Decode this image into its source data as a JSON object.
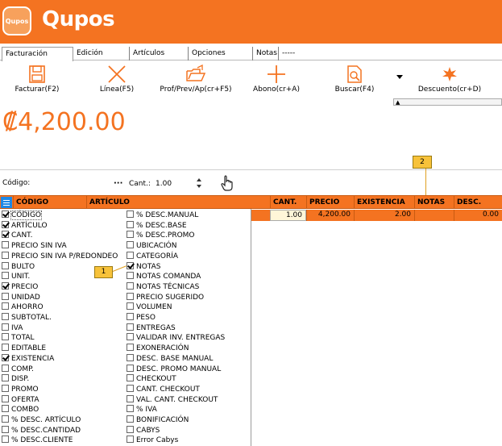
{
  "app": {
    "logo_badge": "Qupos",
    "logo_text": "Qupos",
    "brand_color": "#f47321"
  },
  "tabs": [
    "Facturación",
    "Edición",
    "Artículos",
    "Opciones",
    "Notas",
    "-----"
  ],
  "toolbar": {
    "buttons": [
      {
        "label": "Facturar(F2)",
        "icon": "save-icon"
      },
      {
        "label": "Línea(F5)",
        "icon": "close-x-icon"
      },
      {
        "label": "Prof/Prev/Ap(cr+F5)",
        "icon": "open-folder-icon"
      },
      {
        "label": "Abono(cr+A)",
        "icon": "plus-icon"
      },
      {
        "label": "Buscar(F4)",
        "icon": "search-document-icon"
      },
      {
        "label": "Descuento(cr+D)",
        "icon": "discount-icon"
      }
    ]
  },
  "total": "₡4,200.00",
  "entry": {
    "code_label": "Código:",
    "dots": "···",
    "cant_label": "Cant.:",
    "cant_value": "1.00"
  },
  "grid": {
    "headers": [
      "CÓDIGO",
      "ARTÍCULO",
      "CANT.",
      "PRECIO",
      "EXISTENCIA",
      "NOTAS",
      "DESC."
    ],
    "row": {
      "cant": "1.00",
      "precio": "4,200.00",
      "existencia": "2.00",
      "notas": "",
      "desc": "0.00"
    }
  },
  "chooser": {
    "col1": [
      {
        "label": "CÓDIGO",
        "checked": true
      },
      {
        "label": "ARTÍCULO",
        "checked": true
      },
      {
        "label": "CANT.",
        "checked": true
      },
      {
        "label": "PRECIO SIN IVA",
        "checked": false
      },
      {
        "label": "PRECIO SIN IVA P/REDONDEO",
        "checked": false
      },
      {
        "label": "BULTO",
        "checked": false
      },
      {
        "label": "UNIT.",
        "checked": false
      },
      {
        "label": "PRECIO",
        "checked": true
      },
      {
        "label": "UNIDAD",
        "checked": false
      },
      {
        "label": "AHORRO",
        "checked": false
      },
      {
        "label": "SUBTOTAL.",
        "checked": false
      },
      {
        "label": "IVA",
        "checked": false
      },
      {
        "label": "TOTAL",
        "checked": false
      },
      {
        "label": "EDITABLE",
        "checked": false
      },
      {
        "label": "EXISTENCIA",
        "checked": true
      },
      {
        "label": "COMP.",
        "checked": false
      },
      {
        "label": "DISP.",
        "checked": false
      },
      {
        "label": "PROMO",
        "checked": false
      },
      {
        "label": "OFERTA",
        "checked": false
      },
      {
        "label": "COMBO",
        "checked": false
      },
      {
        "label": "% DESC. ARTÍCULO",
        "checked": false
      },
      {
        "label": "% DESC.CANTIDAD",
        "checked": false
      },
      {
        "label": "% DESC.CLIENTE",
        "checked": false
      }
    ],
    "col2": [
      {
        "label": "% DESC.MANUAL",
        "checked": false
      },
      {
        "label": "% DESC.BASE",
        "checked": false
      },
      {
        "label": "% DESC.PROMO",
        "checked": false
      },
      {
        "label": "UBICACIÓN",
        "checked": false
      },
      {
        "label": "CATEGORÍA",
        "checked": false
      },
      {
        "label": "NOTAS",
        "checked": true
      },
      {
        "label": "NOTAS COMANDA",
        "checked": false
      },
      {
        "label": "NOTAS TÉCNICAS",
        "checked": false
      },
      {
        "label": "PRECIO SUGERIDO",
        "checked": false
      },
      {
        "label": "VOLUMEN",
        "checked": false
      },
      {
        "label": "PESO",
        "checked": false
      },
      {
        "label": "ENTREGAS",
        "checked": false
      },
      {
        "label": "VALIDAR INV. ENTREGAS",
        "checked": false
      },
      {
        "label": "EXONERACIÓN",
        "checked": false
      },
      {
        "label": "DESC. BASE MANUAL",
        "checked": false
      },
      {
        "label": "DESC. PROMO MANUAL",
        "checked": false
      },
      {
        "label": "CHECKOUT",
        "checked": false
      },
      {
        "label": "CANT. CHECKOUT",
        "checked": false
      },
      {
        "label": "VAL. CANT. CHECKOUT",
        "checked": false
      },
      {
        "label": "% IVA",
        "checked": false
      },
      {
        "label": "BONIFICACIÓN",
        "checked": false
      },
      {
        "label": "CABYS",
        "checked": false
      },
      {
        "label": "Error Cabys",
        "checked": false
      }
    ]
  },
  "callouts": {
    "one": "1",
    "two": "2"
  }
}
